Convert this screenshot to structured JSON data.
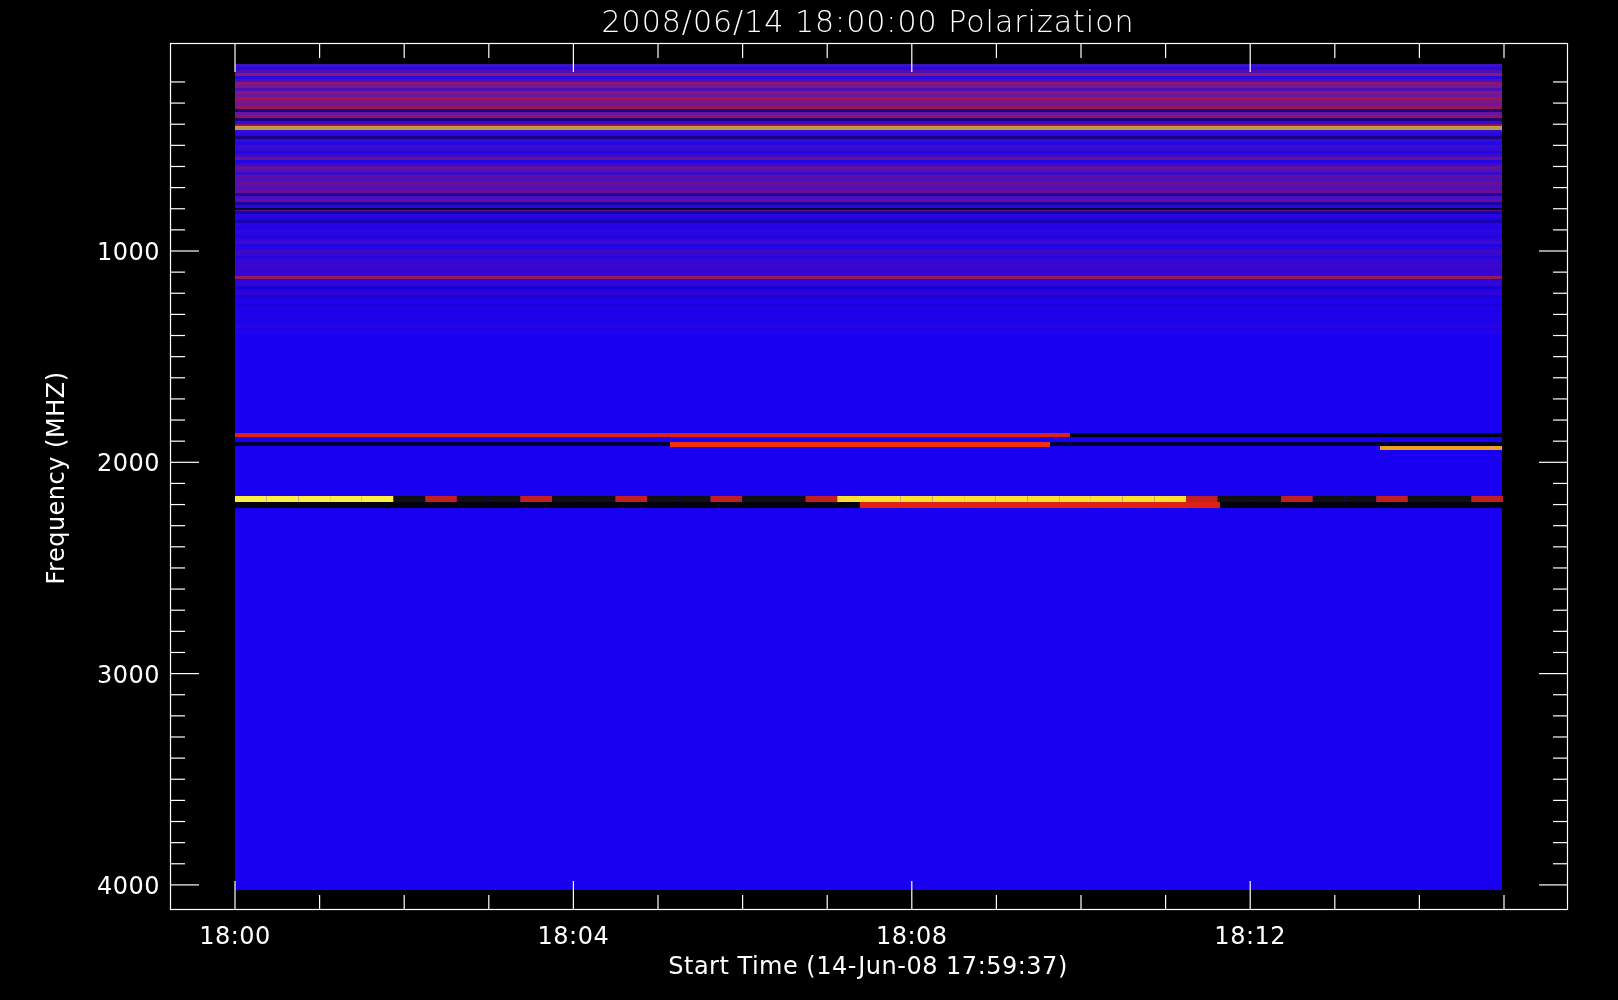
{
  "title": "2008/06/14 18:00:00 Polarization",
  "y_axis": {
    "label": "Frequency (MHZ)",
    "ticks": [
      "1000",
      "2000",
      "3000",
      "4000"
    ]
  },
  "x_axis": {
    "label": "Start Time (14-Jun-08 17:59:37)",
    "ticks": [
      "18:00",
      "18:04",
      "18:08",
      "18:12"
    ]
  }
}
